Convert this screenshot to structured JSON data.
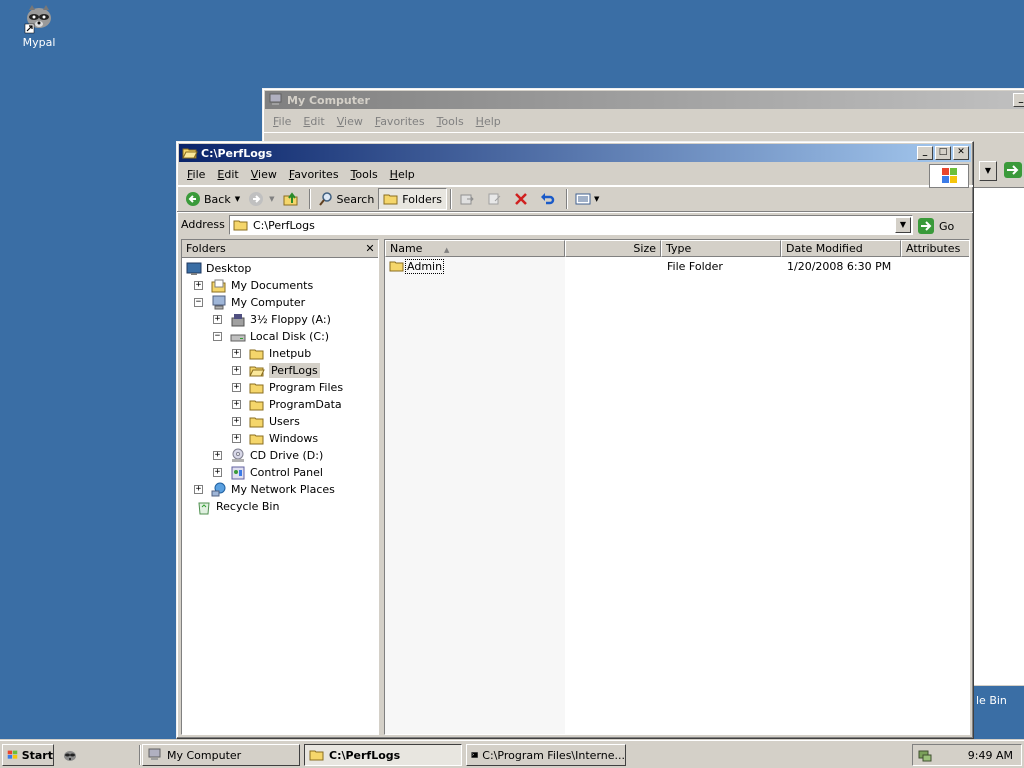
{
  "desktop": {
    "icon_label": "Mypal"
  },
  "back_window": {
    "title": "My Computer",
    "menu": [
      "File",
      "Edit",
      "View",
      "Favorites",
      "Tools",
      "Help"
    ],
    "partial_text": "le Bin"
  },
  "window": {
    "title": "C:\\PerfLogs",
    "menu": [
      "File",
      "Edit",
      "View",
      "Favorites",
      "Tools",
      "Help"
    ],
    "toolbar": {
      "back": "Back",
      "search": "Search",
      "folders": "Folders"
    },
    "address": {
      "label": "Address",
      "value": "C:\\PerfLogs",
      "go": "Go"
    },
    "folders_pane": {
      "title": "Folders",
      "tree": [
        {
          "label": "Desktop",
          "icon": "desktop-icon",
          "expander": ""
        },
        {
          "label": "My Documents",
          "icon": "documents-icon",
          "expander": "+"
        },
        {
          "label": "My Computer",
          "icon": "computer-icon",
          "expander": "-"
        },
        {
          "label": "3½ Floppy (A:)",
          "icon": "floppy-icon",
          "expander": "+"
        },
        {
          "label": "Local Disk (C:)",
          "icon": "disk-icon",
          "expander": "-"
        },
        {
          "label": "Inetpub",
          "icon": "folder-icon",
          "expander": "+"
        },
        {
          "label": "PerfLogs",
          "icon": "folder-open-icon",
          "expander": "+",
          "selected": true
        },
        {
          "label": "Program Files",
          "icon": "folder-icon",
          "expander": "+"
        },
        {
          "label": "ProgramData",
          "icon": "folder-icon",
          "expander": "+"
        },
        {
          "label": "Users",
          "icon": "folder-icon",
          "expander": "+"
        },
        {
          "label": "Windows",
          "icon": "folder-icon",
          "expander": "+"
        },
        {
          "label": "CD Drive (D:)",
          "icon": "cd-icon",
          "expander": "+"
        },
        {
          "label": "Control Panel",
          "icon": "control-panel-icon",
          "expander": "+"
        },
        {
          "label": "My Network Places",
          "icon": "network-icon",
          "expander": "+"
        },
        {
          "label": "Recycle Bin",
          "icon": "recycle-bin-icon",
          "expander": ""
        }
      ]
    },
    "list": {
      "columns": [
        "Name",
        "Size",
        "Type",
        "Date Modified",
        "Attributes"
      ],
      "rows": [
        {
          "name": "Admin",
          "size": "",
          "type": "File Folder",
          "date": "1/20/2008 6:30 PM",
          "attributes": ""
        }
      ]
    }
  },
  "taskbar": {
    "start": "Start",
    "buttons": [
      "My Computer",
      "C:\\PerfLogs",
      "C:\\Program Files\\Interne..."
    ],
    "clock": "9:49 AM"
  }
}
